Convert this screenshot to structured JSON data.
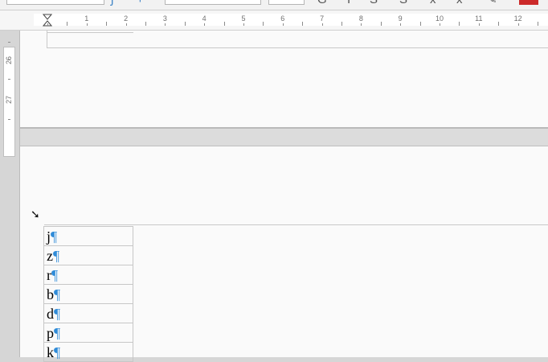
{
  "toolbar": {
    "icons": [
      "character-highlight-icon",
      "text-color-icon",
      "bold-icon",
      "italic-icon",
      "underline-icon",
      "strikethrough-icon",
      "superscript-icon",
      "subscript-icon",
      "clear-formatting-icon",
      "font-color-swatch-icon"
    ]
  },
  "ruler": {
    "horizontal_numbers": [
      "1",
      "2",
      "3",
      "4",
      "5",
      "6",
      "7",
      "8",
      "9",
      "10",
      "11",
      "12"
    ],
    "vertical_numbers": [
      "26",
      "27"
    ]
  },
  "table": {
    "rows": [
      "j",
      "z",
      "r",
      "b",
      "d",
      "p",
      "k"
    ],
    "mark": "¶"
  },
  "colors": {
    "formatting_mark": "#2f8bd8",
    "document_bg": "#fafafa",
    "page_gap": "#dcdcdc"
  }
}
